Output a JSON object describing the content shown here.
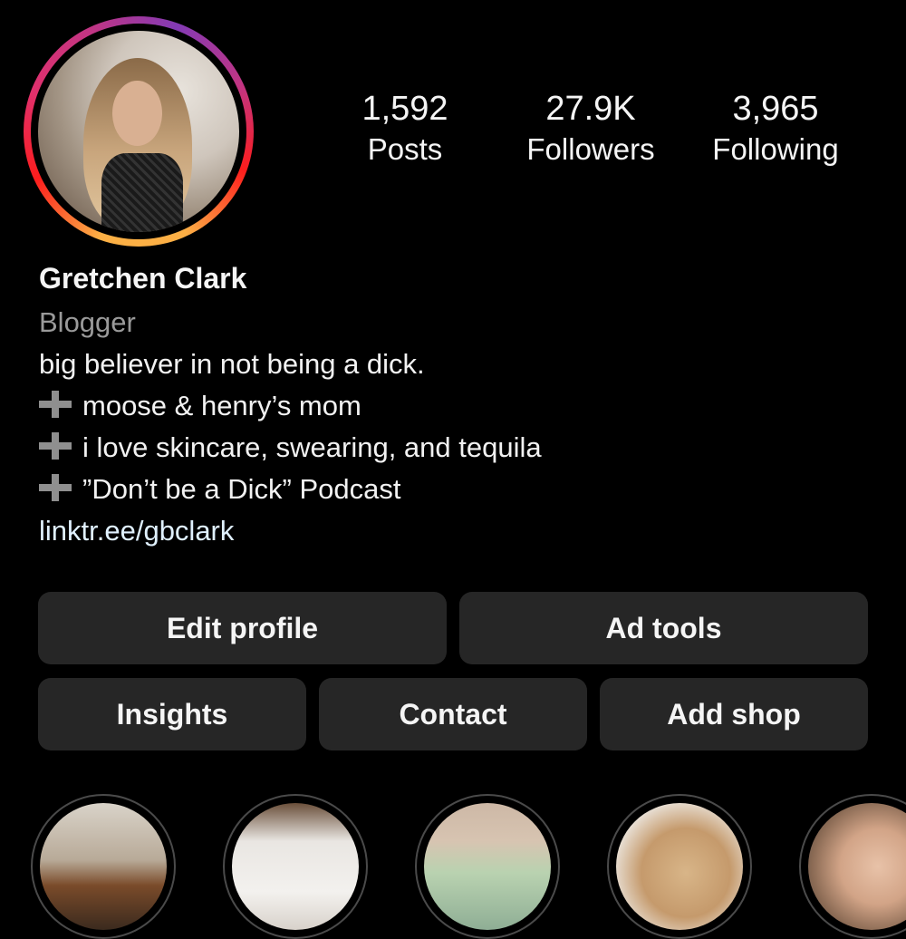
{
  "profile": {
    "name": "Gretchen Clark",
    "category": "Blogger",
    "bio": [
      "big believer in not being a dick.",
      "moose & henry’s mom",
      "i love skincare, swearing, and tequila",
      "”Don’t be a Dick” Podcast"
    ],
    "link": "linktr.ee/gbclark"
  },
  "stats": [
    {
      "value": "1,592",
      "label": "Posts"
    },
    {
      "value": "27.9K",
      "label": "Followers"
    },
    {
      "value": "3,965",
      "label": "Following"
    }
  ],
  "buttons": {
    "edit_profile": "Edit profile",
    "ad_tools": "Ad tools",
    "insights": "Insights",
    "contact": "Contact",
    "add_shop": "Add shop"
  },
  "icons": {
    "bio_bullet": "plus-icon"
  },
  "colors": {
    "background": "#000000",
    "button": "#262626",
    "link": "#e0f1ff",
    "secondary_text": "#9a9a9a",
    "story_ring": [
      "#fcb045",
      "#fd1d1d",
      "#c13584",
      "#833ab4"
    ]
  }
}
